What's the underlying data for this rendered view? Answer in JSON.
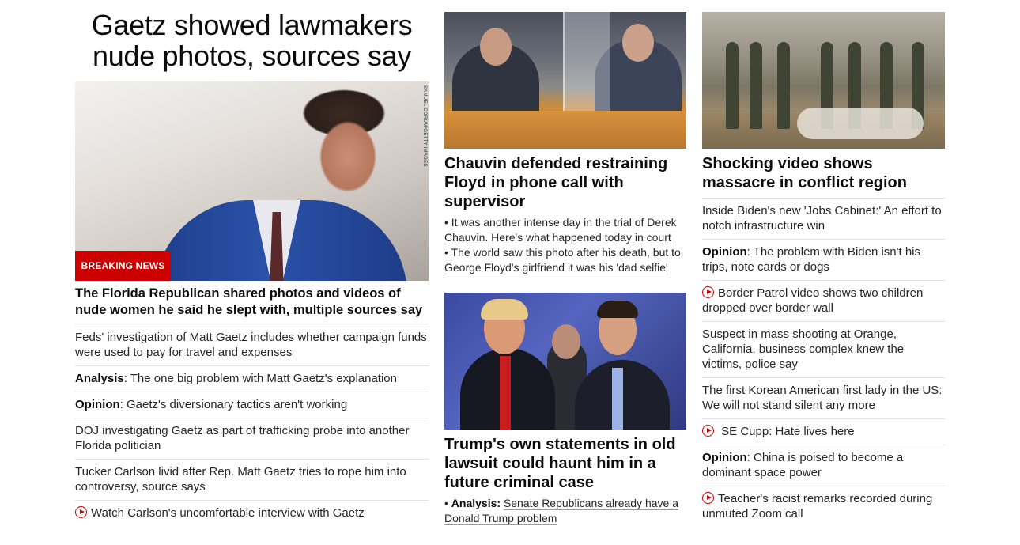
{
  "left": {
    "headline": "Gaetz showed lawmakers nude photos, sources say",
    "image_credit": "SAMUEL CORUM/GETTY IMAGES",
    "badge": "BREAKING NEWS",
    "lede": "The Florida Republican shared photos and videos of nude women he said he slept with, multiple sources say",
    "links": [
      {
        "prefix": "",
        "text": "Feds' investigation of Matt Gaetz includes whether campaign funds were used to pay for travel and expenses",
        "video": false
      },
      {
        "prefix": "Analysis",
        "text": ": The one big problem with Matt Gaetz's explanation",
        "video": false
      },
      {
        "prefix": "Opinion",
        "text": ": Gaetz's diversionary tactics aren't working",
        "video": false
      },
      {
        "prefix": "",
        "text": "DOJ investigating Gaetz as part of trafficking probe into another Florida politician",
        "video": false
      },
      {
        "prefix": "",
        "text": "Tucker Carlson livid after Rep. Matt Gaetz tries to rope him into controversy, source says",
        "video": false
      },
      {
        "prefix": "",
        "text": "Watch Carlson's uncomfortable interview with Gaetz",
        "video": true
      }
    ]
  },
  "middle": {
    "chauvin": {
      "headline": "Chauvin defended restraining Floyd in phone call with supervisor",
      "bullets": [
        {
          "prefix": "",
          "text": "It was another intense day in the trial of Derek Chauvin. Here's what happened today in court"
        },
        {
          "prefix": "",
          "text": "The world saw this photo after his death, but to George Floyd's girlfriend it was his 'dad selfie'"
        }
      ]
    },
    "trump": {
      "headline": "Trump's own statements in old lawsuit could haunt him in a future criminal case",
      "bullets": [
        {
          "prefix": "Analysis:",
          "text": "Senate Republicans already have a Donald Trump problem"
        }
      ]
    }
  },
  "right": {
    "headline": "Shocking video shows massacre in conflict region",
    "links": [
      {
        "prefix": "",
        "text": "Inside Biden's new 'Jobs Cabinet:' An effort to notch infrastructure win",
        "video": false
      },
      {
        "prefix": "Opinion",
        "text": ": The problem with Biden isn't his trips, note cards or dogs",
        "video": false
      },
      {
        "prefix": "",
        "text": "Border Patrol video shows two children dropped over border wall",
        "video": true
      },
      {
        "prefix": "",
        "text": "Suspect in mass shooting at Orange, California, business complex knew the victims, police say",
        "video": false
      },
      {
        "prefix": "",
        "text": "The first Korean American first lady in the US: We will not stand silent any more",
        "video": false
      },
      {
        "prefix": "",
        "text": " SE Cupp: Hate lives here",
        "video": true
      },
      {
        "prefix": "Opinion",
        "text": ": China is poised to become a dominant space power",
        "video": false
      },
      {
        "prefix": "",
        "text": "Teacher's racist remarks recorded during unmuted Zoom call",
        "video": true
      }
    ]
  },
  "colors": {
    "accent": "#cc0000",
    "divider": "#e0e0e0",
    "text": "#262626"
  }
}
